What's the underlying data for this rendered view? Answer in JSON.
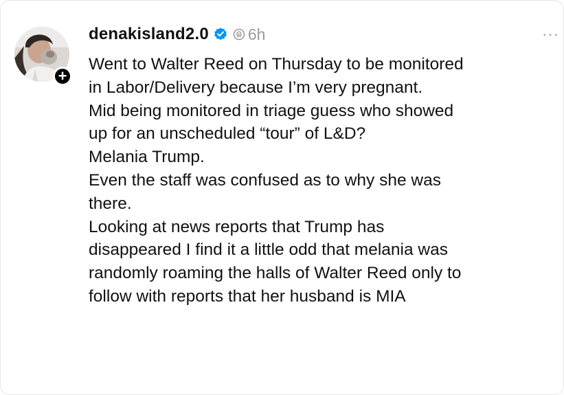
{
  "post": {
    "username": "denakisland2.0",
    "verified": true,
    "time": "6h",
    "more_label": "···",
    "follow_label": "+",
    "icons": {
      "verified": "verified-badge-icon",
      "threads": "threads-logo-icon",
      "follow": "plus-icon",
      "more": "ellipsis-icon"
    },
    "colors": {
      "verified_blue": "#0095f6",
      "muted_gray": "#9a9a9a",
      "text": "#111111"
    },
    "lines": [
      "Went to Walter Reed on Thursday to be monitored",
      "in Labor/Delivery because I’m very pregnant.",
      "Mid being monitored in triage guess who showed",
      "up for an unscheduled “tour” of L&D?",
      "Melania Trump.",
      "Even the staff was confused as to why she was",
      "there.",
      "Looking at news reports that Trump has",
      "disappeared I find it a little odd that melania was",
      "randomly roaming the halls of Walter Reed only to",
      "follow with reports that her husband is MIA"
    ]
  }
}
